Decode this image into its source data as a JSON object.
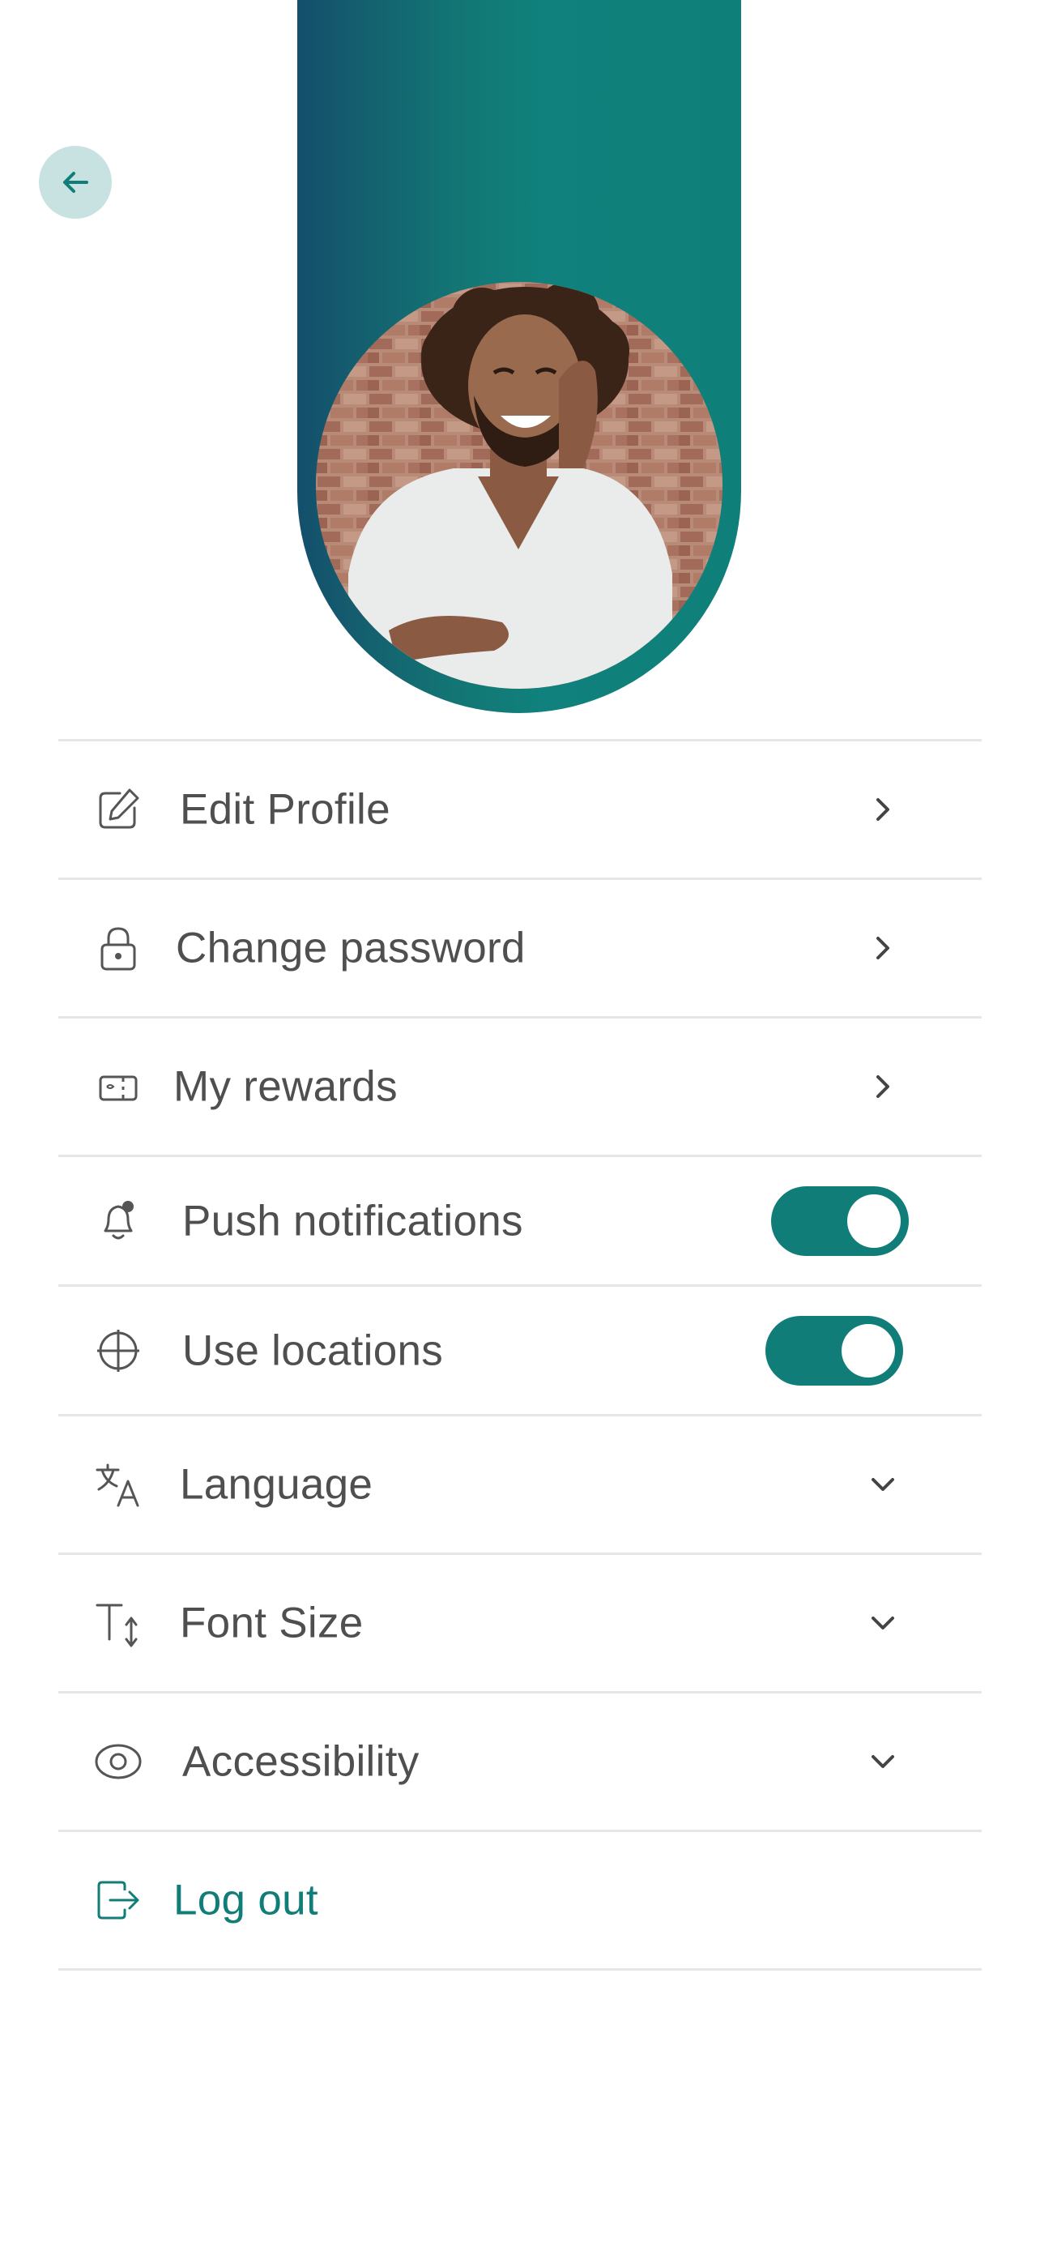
{
  "menu": {
    "edit_profile": "Edit Profile",
    "change_password": "Change password",
    "my_rewards": "My rewards",
    "push_notifications": "Push notifications",
    "use_locations": "Use locations",
    "language": "Language",
    "font_size": "Font Size",
    "accessibility": "Accessibility",
    "log_out": "Log out"
  },
  "toggles": {
    "push_notifications_on": true,
    "use_locations_on": true
  },
  "icons": {
    "back": "arrow-left-icon",
    "edit_profile": "pencil-square-icon",
    "change_password": "lock-icon",
    "my_rewards": "ticket-icon",
    "push_notifications": "bell-icon",
    "use_locations": "crosshair-icon",
    "language": "translate-icon",
    "font_size": "text-size-icon",
    "accessibility": "eye-icon",
    "log_out": "logout-icon",
    "chevron_right": "chevron-right-icon",
    "chevron_down": "chevron-down-icon"
  },
  "colors": {
    "accent": "#117d78",
    "back_button_bg": "#c7e2e1",
    "text": "#4f4f4f",
    "divider": "#e6e6e6",
    "banner_start": "#144f6b",
    "banner_end": "#0f7f7a"
  }
}
